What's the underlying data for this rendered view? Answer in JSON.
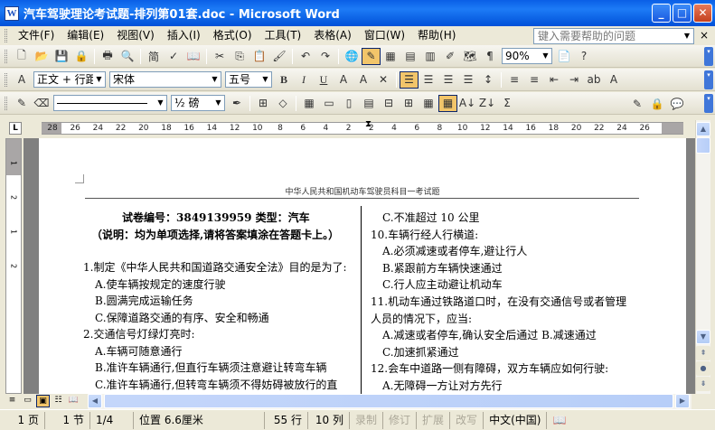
{
  "window": {
    "title": "汽车驾驶理论考试题-排列第01套.doc - Microsoft Word",
    "icon_letter": "W"
  },
  "menu": {
    "items": [
      "文件(F)",
      "编辑(E)",
      "视图(V)",
      "插入(I)",
      "格式(O)",
      "工具(T)",
      "表格(A)",
      "窗口(W)",
      "帮助(H)"
    ],
    "help_placeholder": "键入需要帮助的问题",
    "close": "×"
  },
  "toolbar_std": {
    "zoom": "90%"
  },
  "toolbar_fmt": {
    "style": "正文 + 行距",
    "font": "宋体",
    "size": "五号",
    "bold": "B",
    "italic": "I",
    "underline": "U"
  },
  "toolbar_draw": {
    "line_weight": "½ 磅"
  },
  "ruler": {
    "ticks": [
      "28",
      "26",
      "24",
      "22",
      "20",
      "18",
      "16",
      "14",
      "12",
      "10",
      "8",
      "6",
      "4",
      "2",
      "2",
      "4",
      "6",
      "8",
      "10",
      "12",
      "14",
      "16",
      "18",
      "20",
      "22",
      "24",
      "26"
    ],
    "vticks": [
      "1",
      "2",
      "1",
      "2"
    ]
  },
  "document": {
    "header": "中华人民共和国机动车驾驶员科目一考试题",
    "left": [
      {
        "t": "试卷编号：3849139959    类型：汽车",
        "b": true
      },
      {
        "t": "（说明：均为单项选择,请将答案填涂在答题卡上。）",
        "b": true
      },
      {
        "t": "1.制定《中华人民共和国道路交通安全法》目的是为了:",
        "b": false
      },
      {
        "t": "A.使车辆按规定的速度行驶",
        "b": false
      },
      {
        "t": "B.圆满完成运输任务",
        "b": false
      },
      {
        "t": "C.保障道路交通的有序、安全和畅通",
        "b": false
      },
      {
        "t": "2.交通信号灯绿灯亮时:",
        "b": false
      },
      {
        "t": "A.车辆可随意通行",
        "b": false
      },
      {
        "t": "B.准许车辆通行,但直行车辆须注意避让转弯车辆",
        "b": false
      },
      {
        "t": "C.准许车辆通行,但转弯车辆须不得妨碍被放行的直",
        "b": false
      }
    ],
    "right": [
      "C.不准超过 10 公里",
      "10.车辆行经人行横道:",
      "A.必须减速或者停车,避让行人",
      "B.紧跟前方车辆快速通过",
      "C.行人应主动避让机动车",
      "11.机动车通过铁路道口时，在没有交通信号或者管理",
      "人员的情况下，应当:",
      "A.减速或者停车,确认安全后通过    B.减速通过",
      "C.加速抓紧通过",
      "12.会车中道路一侧有障碍，双方车辆应如何行驶:",
      "A.无障碍一方让对方先行"
    ]
  },
  "status": {
    "page": "1 页",
    "section": "1 节",
    "pages": "1/4",
    "position": "位置 6.6厘米",
    "line": "55 行",
    "col": "10 列",
    "rec": "录制",
    "trk": "修订",
    "ext": "扩展",
    "ovr": "改写",
    "lang": "中文(中国)"
  }
}
